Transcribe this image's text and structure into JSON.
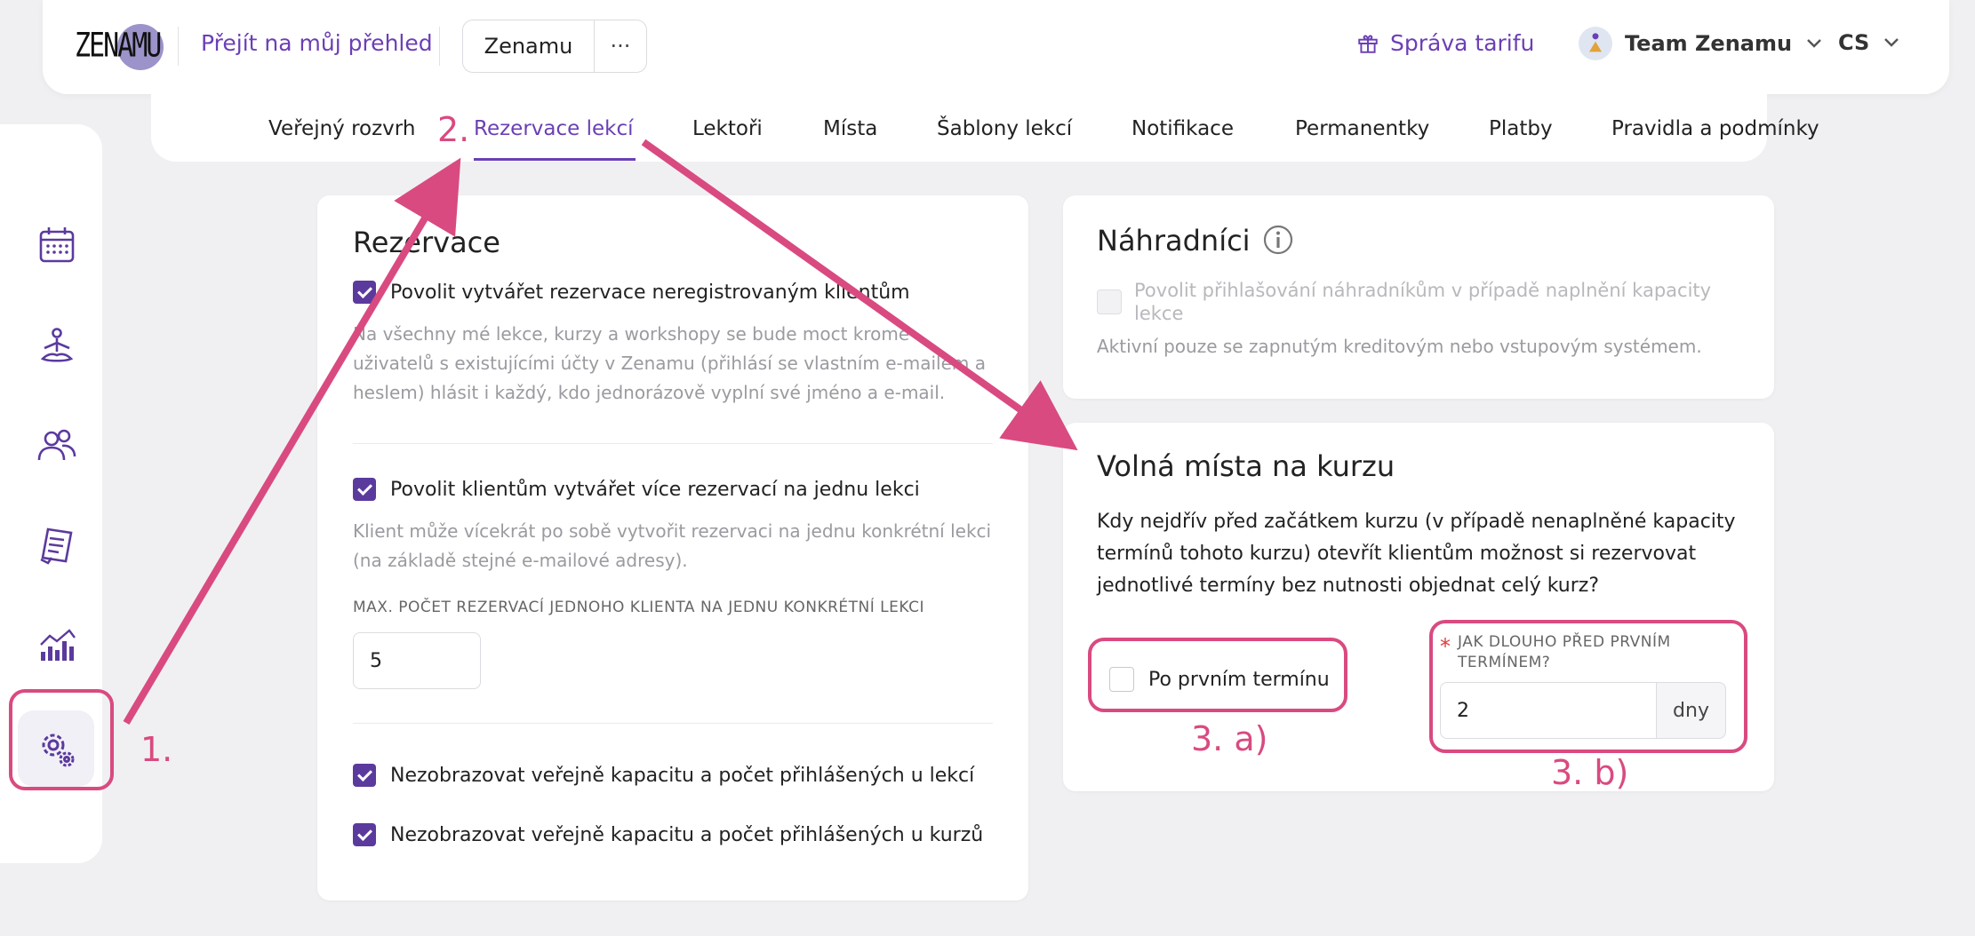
{
  "header": {
    "logo_text": "ZENAMU",
    "overview_link": "Přejít na můj přehled",
    "workspace_name": "Zenamu",
    "workspace_more": "···",
    "tariff_label": "Správa tarifu",
    "team_name": "Team Zenamu",
    "language": "CS"
  },
  "tabs": [
    {
      "label": "Veřejný rozvrh"
    },
    {
      "label": "Rezervace lekcí"
    },
    {
      "label": "Lektoři"
    },
    {
      "label": "Místa"
    },
    {
      "label": "Šablony lekcí"
    },
    {
      "label": "Notifikace"
    },
    {
      "label": "Permanentky"
    },
    {
      "label": "Platby"
    },
    {
      "label": "Pravidla a podmínky"
    }
  ],
  "sidebar": {
    "icons": [
      "calendar-icon",
      "yoga-icon",
      "users-icon",
      "document-icon",
      "chart-icon",
      "settings-icon"
    ]
  },
  "reservations": {
    "title": "Rezervace",
    "opt1_label": "Povolit vytvářet rezervace neregistrovaným klientům",
    "opt1_help": "Na všechny mé lekce, kurzy a workshopy se bude moct kromě uživatelů s existujícími účty v Zenamu (přihlásí se vlastním e-mailem a heslem) hlásit i každý, kdo jednorázově vyplní své jméno a e-mail.",
    "opt2_label": "Povolit klientům vytvářet více rezervací na jednu lekci",
    "opt2_help": "Klient může vícekrát po sobě vytvořit rezervaci na jednu konkrétní lekci (na základě stejné e-mailové adresy).",
    "max_label": "MAX. POČET REZERVACÍ JEDNOHO KLIENTA NA JEDNU KONKRÉTNÍ LEKCI",
    "max_value": "5",
    "opt3_label": "Nezobrazovat veřejně kapacitu a počet přihlášených u lekcí",
    "opt4_label": "Nezobrazovat veřejně kapacitu a počet přihlášených u kurzů"
  },
  "substitutes": {
    "title": "Náhradníci",
    "opt_label": "Povolit přihlašování náhradníkům v případě naplnění kapacity lekce",
    "help": "Aktivní pouze se zapnutým kreditovým nebo vstupovým systémem."
  },
  "free_spots": {
    "title": "Volná místa na kurzu",
    "question": "Kdy nejdřív před začátkem kurzu (v případě nenaplněné kapacity termínů tohoto kurzu) otevřít klientům možnost si rezervovat jednotlivé termíny bez nutnosti objednat celý kurz?",
    "after_first_label": "Po prvním termínu",
    "required_mark": "*",
    "how_long_label": "JAK DLOUHO PŘED PRVNÍM TERMÍNEM?",
    "days_value": "2",
    "days_unit": "dny"
  },
  "annotations": {
    "step1": "1.",
    "step2": "2.",
    "step3a": "3. a)",
    "step3b": "3. b)",
    "color": "#d94a80"
  },
  "colors": {
    "accent": "#6b3fb5",
    "checkbox": "#5b3a9e"
  }
}
